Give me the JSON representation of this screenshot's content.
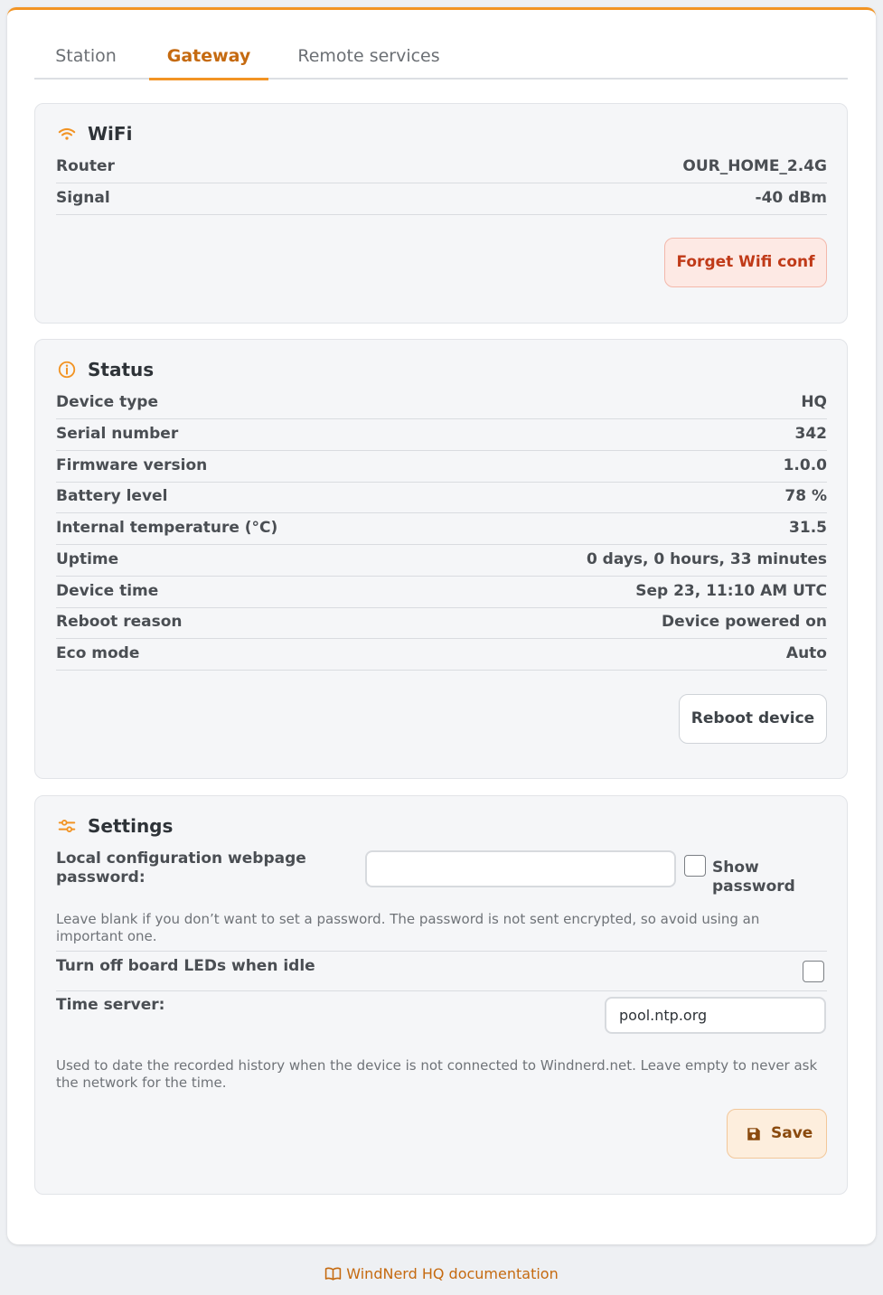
{
  "tabs": [
    {
      "label": "Station"
    },
    {
      "label": "Gateway"
    },
    {
      "label": "Remote services"
    }
  ],
  "active_tab": "Gateway",
  "wifi": {
    "title": "WiFi",
    "icon": "wifi-icon",
    "rows": [
      {
        "key": "Router",
        "value": "OUR_HOME_2.4G"
      },
      {
        "key": "Signal",
        "value": "-40 dBm"
      }
    ],
    "forget_button": "Forget Wifi conf"
  },
  "status": {
    "title": "Status",
    "icon": "info-icon",
    "rows": [
      {
        "key": "Device type",
        "value": "HQ"
      },
      {
        "key": "Serial number",
        "value": "342"
      },
      {
        "key": "Firmware version",
        "value": "1.0.0"
      },
      {
        "key": "Battery level",
        "value": "78 %"
      },
      {
        "key": "Internal temperature (°C)",
        "value": "31.5"
      },
      {
        "key": "Uptime",
        "value": "0 days, 0 hours, 33 minutes"
      },
      {
        "key": "Device time",
        "value": "Sep 23, 11:10 AM UTC"
      },
      {
        "key": "Reboot reason",
        "value": "Device powered on"
      },
      {
        "key": "Eco mode",
        "value": "Auto"
      }
    ],
    "reboot_button": "Reboot device"
  },
  "settings": {
    "title": "Settings",
    "icon": "sliders-icon",
    "password_label": "Local configuration webpage password:",
    "password_value": "",
    "show_password_label": "Show password",
    "show_password_checked": false,
    "password_help": "Leave blank if you don’t want to set a password. The password is not sent encrypted, so avoid using an important one.",
    "leds_label": "Turn off board LEDs when idle",
    "leds_checked": false,
    "time_server_label": "Time server:",
    "time_server_value": "pool.ntp.org",
    "time_server_help": "Used to date the recorded history when the device is not connected to Windnerd.net. Leave empty to never ask the network for the time.",
    "save_button": "Save",
    "save_icon": "floppy-disk-icon"
  },
  "footer": {
    "icon": "book-icon",
    "link_text": "WindNerd HQ documentation"
  },
  "colors": {
    "accent": "#f29424",
    "accent_text": "#c56a10",
    "danger_text": "#c03a18",
    "panel_bg": "#f5f6f8"
  }
}
